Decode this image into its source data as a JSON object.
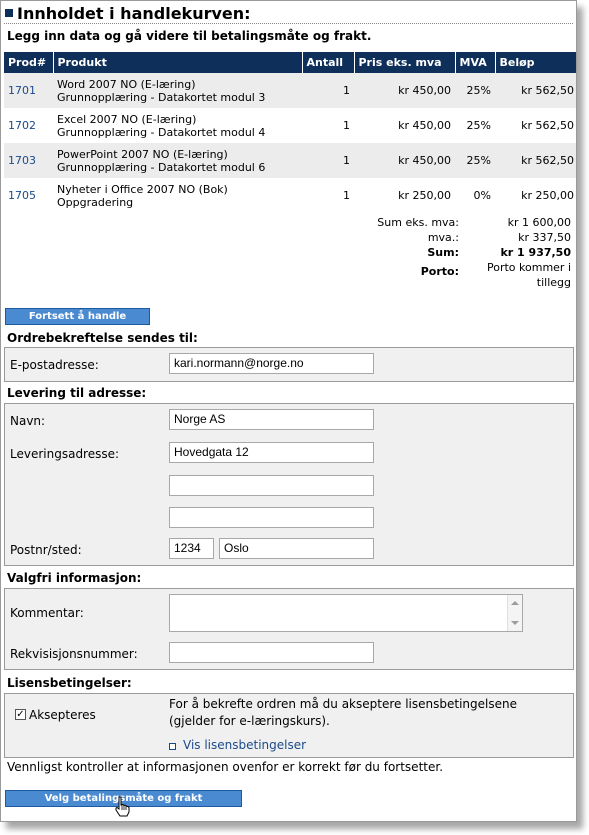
{
  "page": {
    "title": "Innholdet i handlekurven:",
    "intro": "Legg inn data og gå videre til betalingsmåte og frakt."
  },
  "cart": {
    "columns": [
      "Prod#",
      "Produkt",
      "Antall",
      "Pris eks. mva",
      "MVA",
      "Beløp"
    ],
    "rows": [
      {
        "code": "1701",
        "name": "Word 2007 NO (E-læring)",
        "desc": "Grunnopplæring - Datakortet modul 3",
        "qty": "1",
        "price": "kr 450,00",
        "vat": "25%",
        "amount": "kr 562,50"
      },
      {
        "code": "1702",
        "name": "Excel 2007 NO (E-læring)",
        "desc": "Grunnopplæring - Datakortet modul 4",
        "qty": "1",
        "price": "kr 450,00",
        "vat": "25%",
        "amount": "kr 562,50"
      },
      {
        "code": "1703",
        "name": "PowerPoint 2007 NO (E-læring)",
        "desc": "Grunnopplæring - Datakortet modul 6",
        "qty": "1",
        "price": "kr 450,00",
        "vat": "25%",
        "amount": "kr 562,50"
      },
      {
        "code": "1705",
        "name": "Nyheter i Office 2007 NO (Bok)",
        "desc": "Oppgradering",
        "qty": "1",
        "price": "kr 250,00",
        "vat": "0%",
        "amount": "kr 250,00"
      }
    ],
    "summary": {
      "sum_ex_label": "Sum eks. mva:",
      "sum_ex_value": "kr 1 600,00",
      "vat_label": "mva.:",
      "vat_value": "kr 337,50",
      "sum_label": "Sum:",
      "sum_value": "kr 1 937,50",
      "postage_label": "Porto:",
      "postage_value_1": "Porto kommer i",
      "postage_value_2": "tillegg"
    }
  },
  "buttons": {
    "continue_shopping": "Fortsett å handle",
    "choose_payment": "Velg betalingsmåte og frakt"
  },
  "order_confirmation": {
    "title": "Ordrebekreftelse sendes til:",
    "email_label": "E-postadresse:",
    "email_value": "kari.normann@norge.no"
  },
  "delivery": {
    "title": "Levering til adresse:",
    "name_label": "Navn:",
    "name_value": "Norge AS",
    "address_label": "Leveringsadresse:",
    "address_value": "Hovedgata 12",
    "address2_value": "",
    "address3_value": "",
    "postal_label": "Postnr/sted:",
    "postal_code": "1234",
    "city": "Oslo"
  },
  "optional": {
    "title": "Valgfri informasjon:",
    "comment_label": "Kommentar:",
    "comment_value": "",
    "requisition_label": "Rekvisisjonsnummer:",
    "requisition_value": ""
  },
  "license": {
    "title": "Lisensbetingelser:",
    "accept_label": "Aksepteres",
    "accept_checked": true,
    "check_glyph": "✓",
    "info_line1": "For å bekrefte ordren må du akseptere lisensbetingelsene",
    "info_line2": "(gjelder for e-læringskurs).",
    "link": "Vis lisensbetingelser"
  },
  "footer_note": "Vennligst kontroller at informasjonen ovenfor er korrekt før du fortsetter.",
  "icons": [
    "bullet-square-icon",
    "hand-pointer-icon"
  ],
  "colors": {
    "header_bg": "#0e2f5a",
    "button_bg": "#4a8ad0",
    "link": "#1a4a8a",
    "box_bg": "#f0f0f0"
  }
}
